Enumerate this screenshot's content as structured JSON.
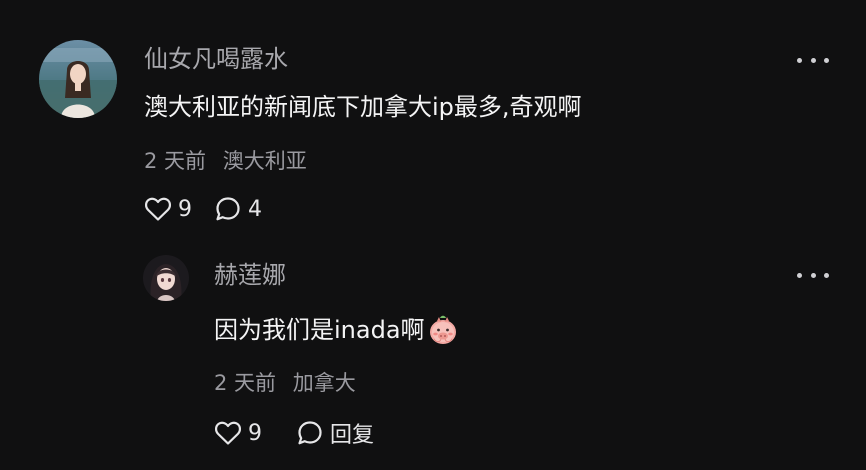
{
  "comments": [
    {
      "username": "仙女凡喝露水",
      "text": "澳大利亚的新闻底下加拿大ip最多,奇观啊",
      "time": "2 天前",
      "location": "澳大利亚",
      "likes": "9",
      "replies": "4",
      "avatar_icon": "girl-portrait-avatar"
    },
    {
      "username": "赫莲娜",
      "text": "因为我们是inada啊",
      "time": "2 天前",
      "location": "加拿大",
      "likes": "9",
      "reply_label": "回复",
      "emoji_icon": "shy-pig-sticker",
      "avatar_icon": "anime-girl-avatar"
    }
  ]
}
